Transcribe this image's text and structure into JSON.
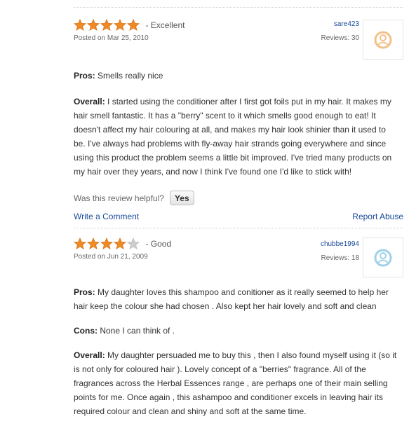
{
  "reviews": [
    {
      "rating": 5,
      "rating_label": "- Excellent",
      "posted": "Posted on Mar 25, 2010",
      "username": "sare423",
      "reviews_count": "Reviews: 30",
      "pros_label": "Pros:",
      "pros": " Smells really nice",
      "overall_label": "Overall:",
      "overall_lines": [
        " I started using the conditioner after I first got foils put in my hair. It makes my",
        "hair smell fantastic. It has a \"berry\" scent to it which smells good enough to eat! It",
        "doesn't affect my hair colouring at all, and makes my hair look shinier than it used to",
        "be. I've always had problems with fly-away hair strands going everywhere and since",
        "using this product the problem seems a little bit improved. I've tried many products on",
        "my hair over they years, and now I think I've found one I'd like to stick with!"
      ],
      "helpful_question": "Was this review helpful?",
      "yes_label": "Yes",
      "write_comment": "Write a Comment",
      "report_abuse": "Report Abuse"
    },
    {
      "rating": 4,
      "rating_label": "- Good",
      "posted": "Posted on Jun 21, 2009",
      "username": "chubbe1994",
      "reviews_count": "Reviews: 18",
      "pros_label": "Pros:",
      "pros_lines": [
        " My daughter loves this shampoo and conitioner as it really seemed to help her",
        "hair keep the colour she had chosen . Also kept her hair lovely and soft and clean"
      ],
      "cons_label": "Cons:",
      "cons": " None I can think of .",
      "overall_label": "Overall:",
      "overall_lines": [
        " My daughter persuaded me to buy this , then I also found myself using it (so it",
        "is not only for coloured hair ). Lovely concept of a \"berries\" fragrance. All of the",
        "fragrances across the Herbal Essences range , are perhaps one of their main selling",
        "points for me. Once again , this ashampoo and conditioner excels in leaving hair its",
        "required colour and clean and shiny and soft at the same time."
      ]
    }
  ],
  "colors": {
    "star_on": "#f08a24",
    "star_off": "#cccccc",
    "link": "#1a4a9a",
    "avatar_1": "#f3c08a",
    "avatar_2": "#9fd2e8"
  },
  "icons": {
    "star": "star-icon",
    "avatar": "default-avatar-icon"
  }
}
